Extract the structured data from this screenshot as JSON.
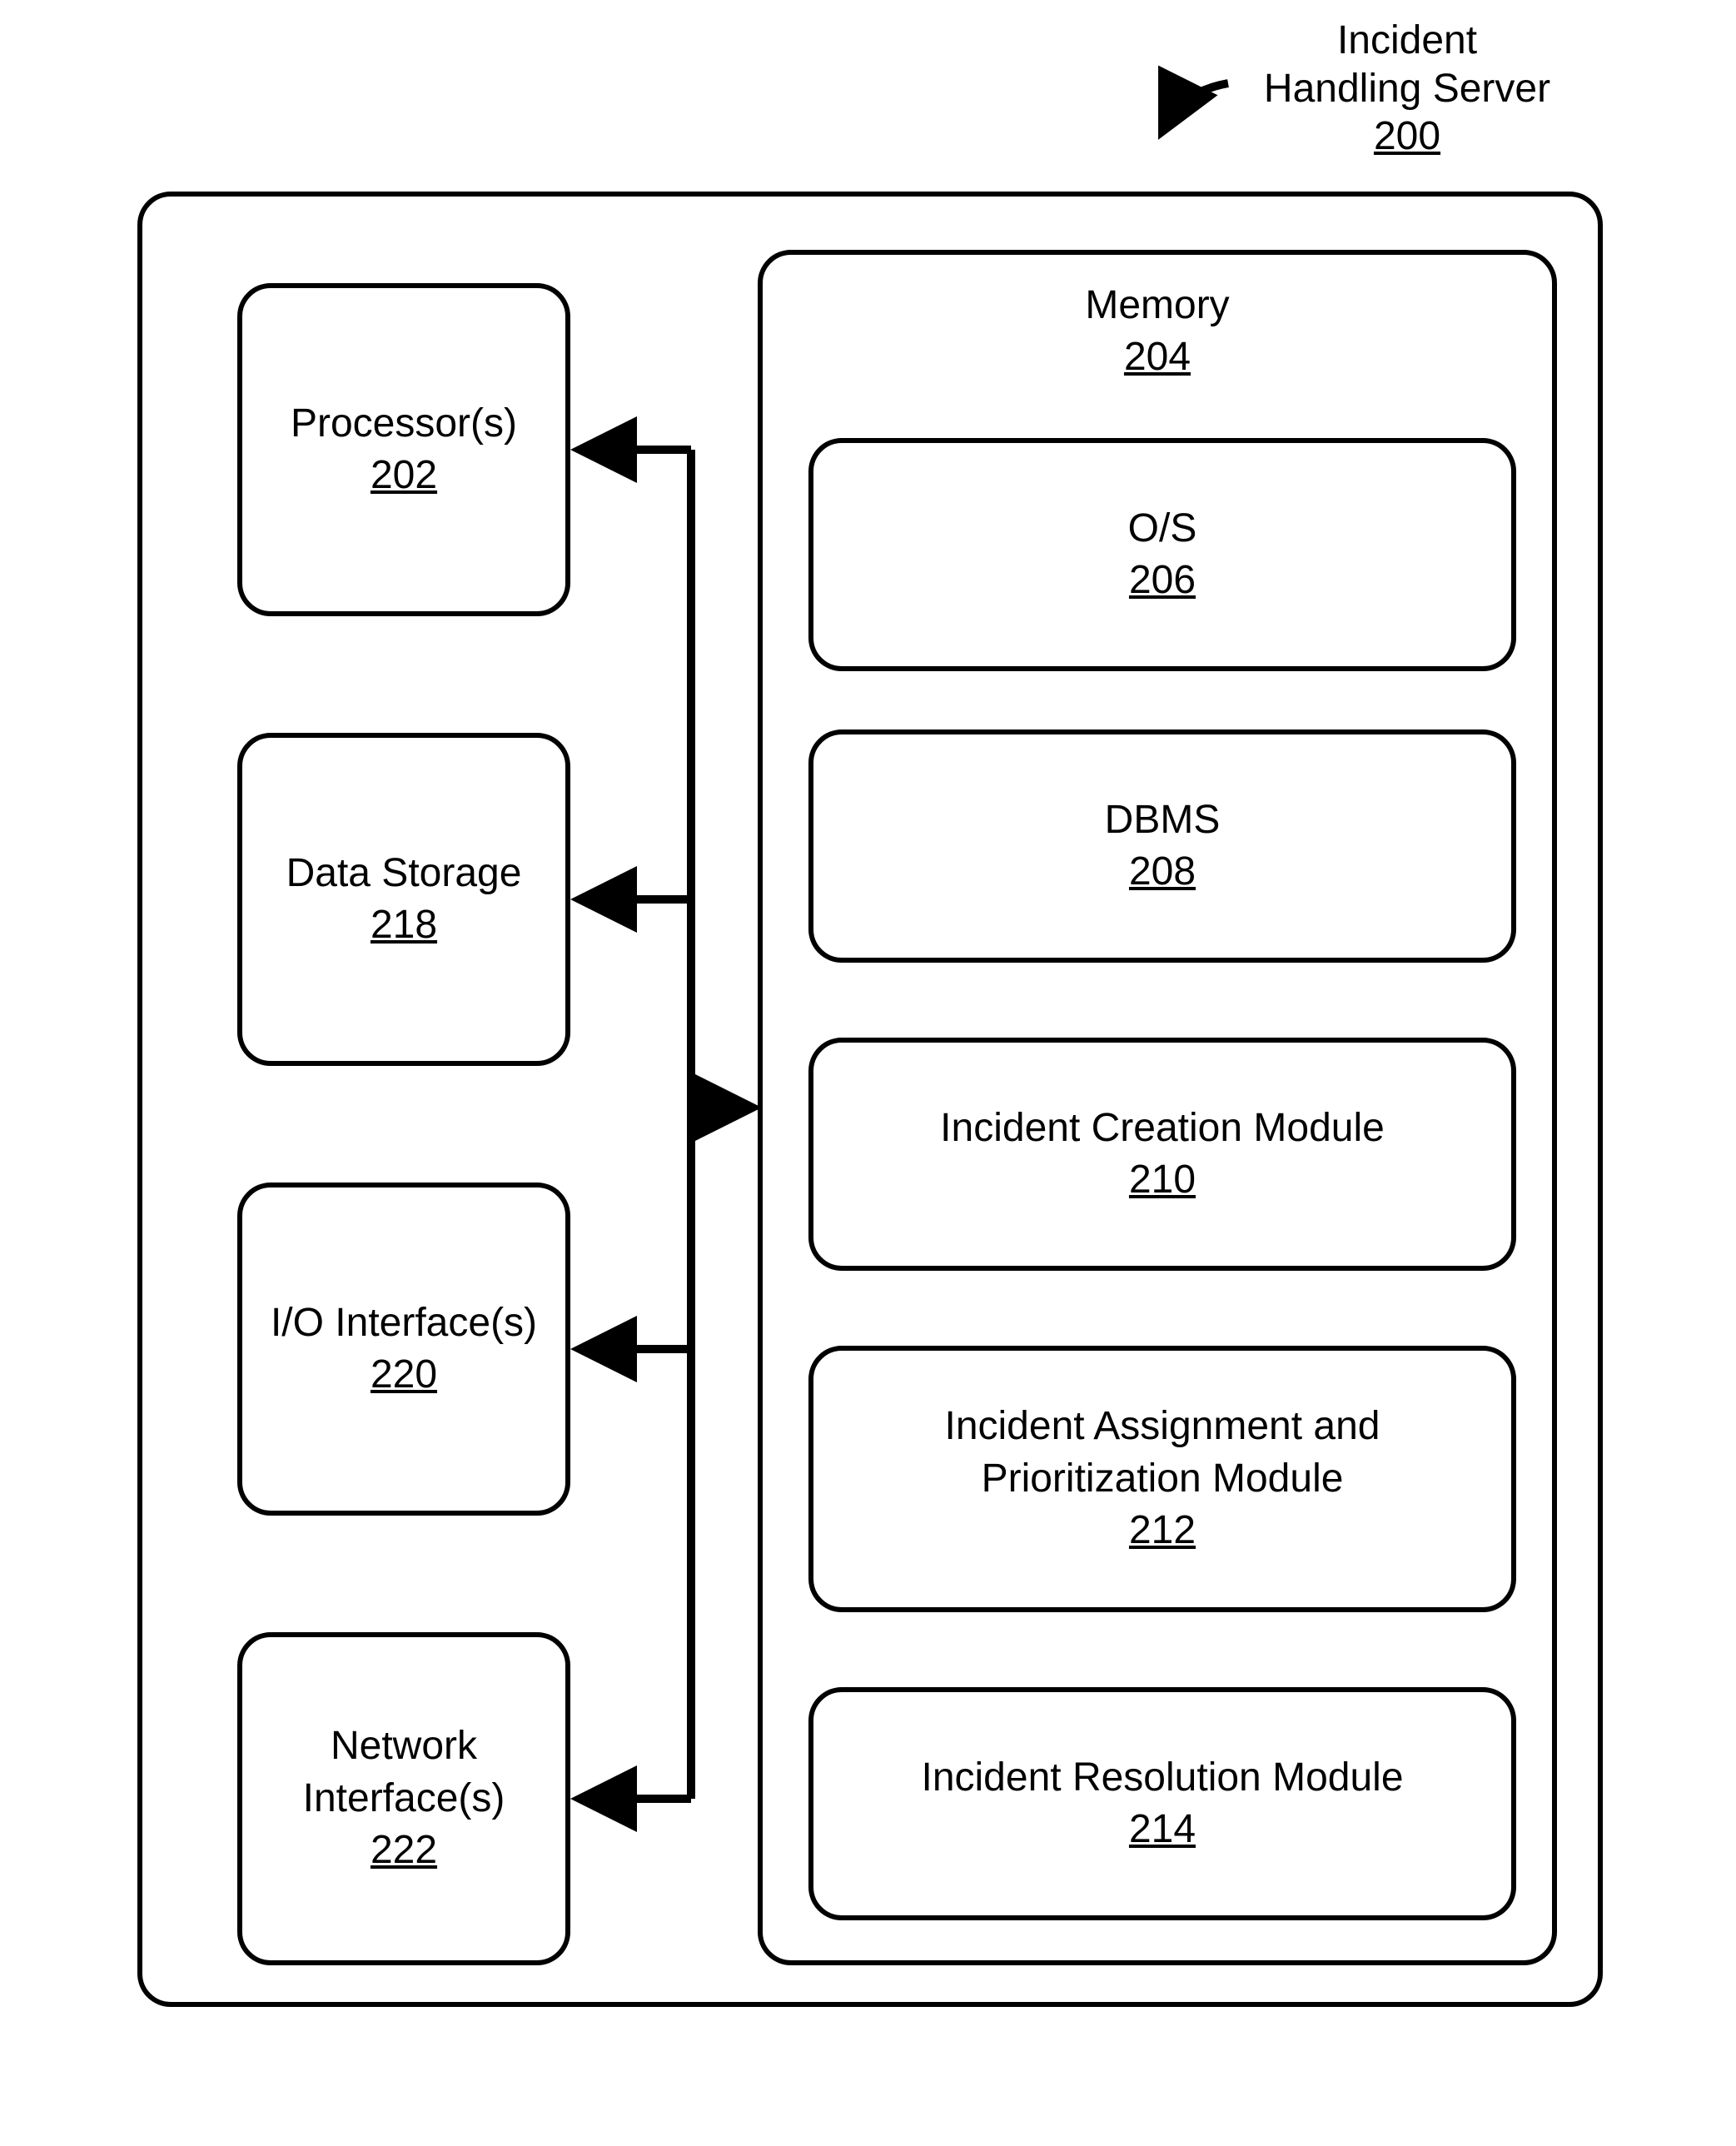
{
  "title": {
    "line1": "Incident",
    "line2": "Handling Server",
    "ref": "200"
  },
  "left_boxes": {
    "processor": {
      "label": "Processor(s)",
      "ref": "202"
    },
    "storage": {
      "label": "Data Storage",
      "ref": "218"
    },
    "io": {
      "label": "I/O Interface(s)",
      "ref": "220"
    },
    "network": {
      "line1": "Network",
      "line2": "Interface(s)",
      "ref": "222"
    }
  },
  "memory": {
    "label": "Memory",
    "ref": "204",
    "modules": {
      "os": {
        "label": "O/S",
        "ref": "206"
      },
      "dbms": {
        "label": "DBMS",
        "ref": "208"
      },
      "creation": {
        "label": "Incident Creation Module",
        "ref": "210"
      },
      "assignment": {
        "line1": "Incident Assignment and",
        "line2": "Prioritization Module",
        "ref": "212"
      },
      "resolution": {
        "label": "Incident Resolution Module",
        "ref": "214"
      }
    }
  }
}
